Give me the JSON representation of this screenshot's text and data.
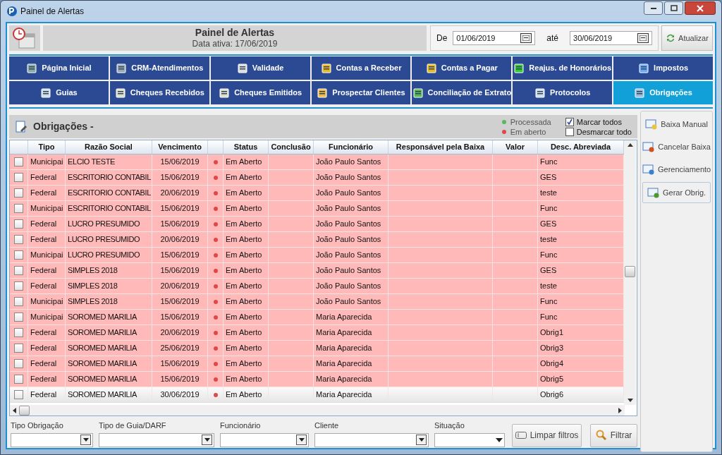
{
  "window": {
    "title": "Painel de Alertas"
  },
  "header": {
    "title": "Painel de Alertas",
    "subtitle": "Data ativa: 17/06/2019",
    "from_label": "De",
    "from": "01/06/2019",
    "to_label": "até",
    "to": "30/06/2019",
    "refresh": "Atualizar"
  },
  "nav": [
    {
      "label": "Página Inicial",
      "selected": false
    },
    {
      "label": "CRM-Atendimentos",
      "selected": false
    },
    {
      "label": "Validade",
      "selected": false
    },
    {
      "label": "Contas a Receber",
      "selected": false
    },
    {
      "label": "Contas a Pagar",
      "selected": false
    },
    {
      "label": "Reajus. de Honorários",
      "selected": false
    },
    {
      "label": "Impostos",
      "selected": false
    },
    {
      "label": "Guias",
      "selected": false
    },
    {
      "label": "Cheques Recebidos",
      "selected": false
    },
    {
      "label": "Cheques Emitidos",
      "selected": false
    },
    {
      "label": "Prospectar Clientes",
      "selected": false
    },
    {
      "label": "Conciliação de Extrato",
      "selected": false
    },
    {
      "label": "Protocolos",
      "selected": false
    },
    {
      "label": "Obrigações",
      "selected": true
    }
  ],
  "panel": {
    "title": "Obrigações -",
    "legend": [
      {
        "label": "Processada",
        "color": "#5cb85c"
      },
      {
        "label": "Em aberto",
        "color": "#e04848"
      }
    ],
    "mark_all": {
      "label": "Marcar todos",
      "checked": true
    },
    "unmark_all": {
      "label": "Desmarcar todo",
      "checked": false
    }
  },
  "table": {
    "columns": [
      "Tipo",
      "Razão Social",
      "Vencimento",
      "Status",
      "Conclusão",
      "Funcionário",
      "Responsável pela Baixa",
      "Valor",
      "Desc. Abreviada"
    ],
    "rows": [
      {
        "checked": false,
        "selected": false,
        "tipo": "Municipai",
        "razao": "ELCIO TESTE",
        "vencimento": "15/06/2019",
        "color": "#e04848",
        "status": "Em Aberto",
        "funcionario": "João Paulo Santos",
        "desc": "Func"
      },
      {
        "checked": false,
        "selected": false,
        "tipo": "Federal",
        "razao": "ESCRITORIO CONTABIL",
        "vencimento": "15/06/2019",
        "color": "#e04848",
        "status": "Em Aberto",
        "funcionario": "João Paulo Santos",
        "desc": "GES"
      },
      {
        "checked": false,
        "selected": false,
        "tipo": "Federal",
        "razao": "ESCRITORIO CONTABIL",
        "vencimento": "20/06/2019",
        "color": "#e04848",
        "status": "Em Aberto",
        "funcionario": "João Paulo Santos",
        "desc": "teste"
      },
      {
        "checked": false,
        "selected": false,
        "tipo": "Municipai",
        "razao": "ESCRITORIO CONTABIL",
        "vencimento": "15/06/2019",
        "color": "#e04848",
        "status": "Em Aberto",
        "funcionario": "João Paulo Santos",
        "desc": "Func"
      },
      {
        "checked": false,
        "selected": false,
        "tipo": "Federal",
        "razao": "LUCRO PRESUMIDO",
        "vencimento": "15/06/2019",
        "color": "#e04848",
        "status": "Em Aberto",
        "funcionario": "João Paulo Santos",
        "desc": "GES"
      },
      {
        "checked": false,
        "selected": false,
        "tipo": "Federal",
        "razao": "LUCRO PRESUMIDO",
        "vencimento": "20/06/2019",
        "color": "#e04848",
        "status": "Em Aberto",
        "funcionario": "João Paulo Santos",
        "desc": "teste"
      },
      {
        "checked": false,
        "selected": false,
        "tipo": "Municipai",
        "razao": "LUCRO PRESUMIDO",
        "vencimento": "15/06/2019",
        "color": "#e04848",
        "status": "Em Aberto",
        "funcionario": "João Paulo Santos",
        "desc": "Func"
      },
      {
        "checked": false,
        "selected": false,
        "tipo": "Federal",
        "razao": "SIMPLES 2018",
        "vencimento": "15/06/2019",
        "color": "#e04848",
        "status": "Em Aberto",
        "funcionario": "João Paulo Santos",
        "desc": "GES"
      },
      {
        "checked": false,
        "selected": false,
        "tipo": "Federal",
        "razao": "SIMPLES 2018",
        "vencimento": "20/06/2019",
        "color": "#e04848",
        "status": "Em Aberto",
        "funcionario": "João Paulo Santos",
        "desc": "teste"
      },
      {
        "checked": false,
        "selected": false,
        "tipo": "Municipai",
        "razao": "SIMPLES 2018",
        "vencimento": "15/06/2019",
        "color": "#e04848",
        "status": "Em Aberto",
        "funcionario": "João Paulo Santos",
        "desc": "Func"
      },
      {
        "checked": false,
        "selected": false,
        "tipo": "Municipai",
        "razao": "SOROMED MARILIA",
        "vencimento": "15/06/2019",
        "color": "#e04848",
        "status": "Em Aberto",
        "funcionario": "Maria Aparecida",
        "desc": "Func"
      },
      {
        "checked": false,
        "selected": false,
        "tipo": "Federal",
        "razao": "SOROMED MARILIA",
        "vencimento": "20/06/2019",
        "color": "#e04848",
        "status": "Em Aberto",
        "funcionario": "Maria Aparecida",
        "desc": "Obrig1"
      },
      {
        "checked": false,
        "selected": false,
        "tipo": "Federal",
        "razao": "SOROMED MARILIA",
        "vencimento": "25/06/2019",
        "color": "#e04848",
        "status": "Em Aberto",
        "funcionario": "Maria Aparecida",
        "desc": "Obrig3"
      },
      {
        "checked": false,
        "selected": false,
        "tipo": "Federal",
        "razao": "SOROMED MARILIA",
        "vencimento": "15/06/2019",
        "color": "#e04848",
        "status": "Em Aberto",
        "funcionario": "Maria Aparecida",
        "desc": "Obrig4"
      },
      {
        "checked": false,
        "selected": false,
        "tipo": "Federal",
        "razao": "SOROMED MARILIA",
        "vencimento": "15/06/2019",
        "color": "#e04848",
        "status": "Em Aberto",
        "funcionario": "Maria Aparecida",
        "desc": "Obrig5"
      },
      {
        "checked": false,
        "selected": true,
        "tipo": "Federal",
        "razao": "SOROMED MARILIA",
        "vencimento": "30/06/2019",
        "color": "#e04848",
        "status": "Em Aberto",
        "funcionario": "Maria Aparecida",
        "desc": "Obrig6"
      }
    ]
  },
  "side_actions": [
    {
      "label": "Baixa Manual"
    },
    {
      "label": "Cancelar Baixa"
    },
    {
      "label": "Gerenciamento"
    },
    {
      "label": "Gerar Obrig."
    }
  ],
  "filters": [
    {
      "label": "Tipo Obrigação"
    },
    {
      "label": "Tipo de Guia/DARF"
    },
    {
      "label": "Funcionário"
    },
    {
      "label": "Cliente"
    },
    {
      "label": "Situação"
    }
  ],
  "filter_buttons": [
    "Limpar filtros",
    "Filtrar"
  ]
}
